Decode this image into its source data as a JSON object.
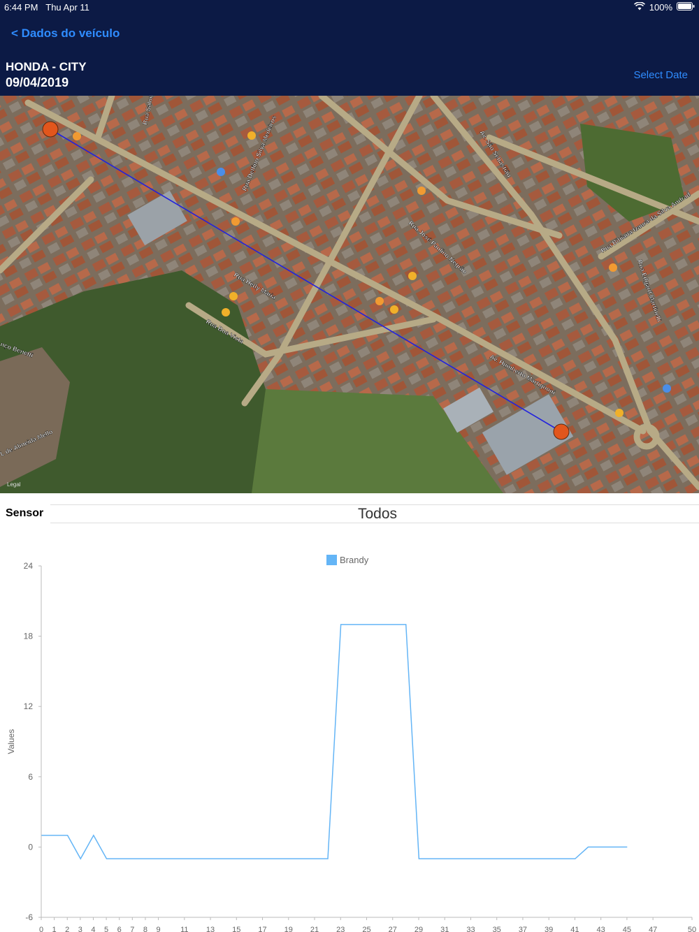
{
  "status_bar": {
    "time": "6:44 PM",
    "date": "Thu Apr 11",
    "battery": "100%"
  },
  "nav": {
    "back_label": "< Dados do veículo",
    "select_date_label": "Select Date"
  },
  "vehicle": {
    "name": "HONDA - CITY",
    "date": "09/04/2019"
  },
  "map": {
    "legal": "Legal",
    "streets": [
      "Rua Salom",
      "Rua Delfino Silva Medeiros",
      "Av. São Sebastião",
      "Rua José Paulino Negrão",
      "Rua Hedy Maria",
      "Rua Boa Vista",
      "Av. Humberto Martignoni",
      "Rua Bibiana Izaura da Silva Andrad",
      "Rua Edgard Martinelli",
      "nço Benetti",
      "L de Almeida Mello"
    ]
  },
  "sensor": {
    "label": "Sensor",
    "selected": "Todos"
  },
  "chart_data": {
    "type": "line",
    "ylabel": "Values",
    "ylim": [
      -6,
      24
    ],
    "yticks": [
      -6,
      0,
      6,
      12,
      18,
      24
    ],
    "xlim": [
      0,
      50
    ],
    "xticks": [
      0,
      1,
      2,
      3,
      4,
      5,
      6,
      7,
      8,
      9,
      11,
      13,
      15,
      17,
      19,
      21,
      23,
      25,
      27,
      29,
      31,
      33,
      35,
      37,
      39,
      41,
      43,
      45,
      47,
      50
    ],
    "legend_position": "top",
    "series": [
      {
        "name": "Brandy",
        "color": "#64b5f6",
        "x": [
          0,
          1,
          2,
          3,
          4,
          5,
          6,
          7,
          8,
          9,
          10,
          11,
          12,
          13,
          14,
          15,
          16,
          17,
          18,
          19,
          20,
          21,
          22,
          23,
          24,
          25,
          26,
          27,
          28,
          29,
          30,
          31,
          32,
          33,
          34,
          35,
          36,
          37,
          38,
          39,
          40,
          41,
          42,
          43,
          44,
          45
        ],
        "y": [
          1,
          1,
          1,
          -1,
          1,
          -1,
          -1,
          -1,
          -1,
          -1,
          -1,
          -1,
          -1,
          -1,
          -1,
          -1,
          -1,
          -1,
          -1,
          -1,
          -1,
          -1,
          -1,
          19,
          19,
          19,
          19,
          19,
          19,
          -1,
          -1,
          -1,
          -1,
          -1,
          -1,
          -1,
          -1,
          -1,
          -1,
          -1,
          -1,
          -1,
          0,
          0,
          0,
          0
        ]
      }
    ]
  }
}
